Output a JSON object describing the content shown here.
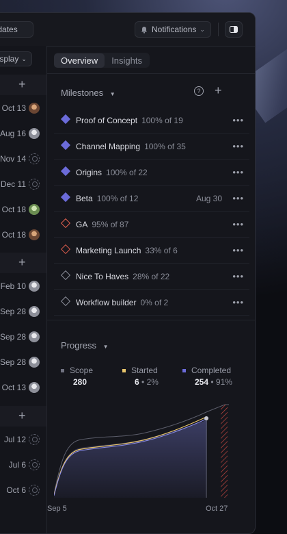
{
  "topbar": {
    "updates_label": "Updates",
    "notifications_label": "Notifications",
    "notifications_icon": "bell-icon",
    "layout_icon": "panel-toggle-icon"
  },
  "sidebar": {
    "display_label": "Display",
    "group1_dates": [
      "Oct 13",
      "Aug 16",
      "Nov 14",
      "Dec 11",
      "Oct 18",
      "Oct 18"
    ],
    "group2_dates": [
      "Feb 10",
      "Sep 28",
      "Sep 28",
      "Sep 28",
      "Oct 13"
    ],
    "group3_dates": [
      "Jul 12",
      "Jul 6",
      "Oct 6"
    ]
  },
  "tabs": {
    "overview": "Overview",
    "insights": "Insights"
  },
  "milestones": {
    "header": "Milestones",
    "items": [
      {
        "name": "Proof of Concept",
        "progress": "100% of 19",
        "date": "",
        "color": "#6b6bd9"
      },
      {
        "name": "Channel Mapping",
        "progress": "100% of 35",
        "date": "",
        "color": "#6b6bd9"
      },
      {
        "name": "Origins",
        "progress": "100% of 22",
        "date": "",
        "color": "#6b6bd9"
      },
      {
        "name": "Beta",
        "progress": "100% of 12",
        "date": "Aug 30",
        "color": "#6b6bd9"
      },
      {
        "name": "GA",
        "progress": "95% of 87",
        "date": "",
        "color": "#e0614f"
      },
      {
        "name": "Marketing Launch",
        "progress": "33% of 6",
        "date": "",
        "color": "#d1584a"
      },
      {
        "name": "Nice To Haves",
        "progress": "28% of 22",
        "date": "",
        "color": "#8a8d98"
      },
      {
        "name": "Workflow builder",
        "progress": "0% of 2",
        "date": "",
        "color": "#8a8d98"
      }
    ]
  },
  "progress": {
    "header": "Progress",
    "scope_label": "Scope",
    "scope_value": "280",
    "started_label": "Started",
    "started_value": "6",
    "started_pct": "2%",
    "completed_label": "Completed",
    "completed_value": "254",
    "completed_pct": "91%",
    "x_start": "Sep 5",
    "x_end": "Oct 27",
    "colors": {
      "scope": "#6f7180",
      "started": "#e8c56b",
      "completed": "#6b6bd9"
    }
  }
}
